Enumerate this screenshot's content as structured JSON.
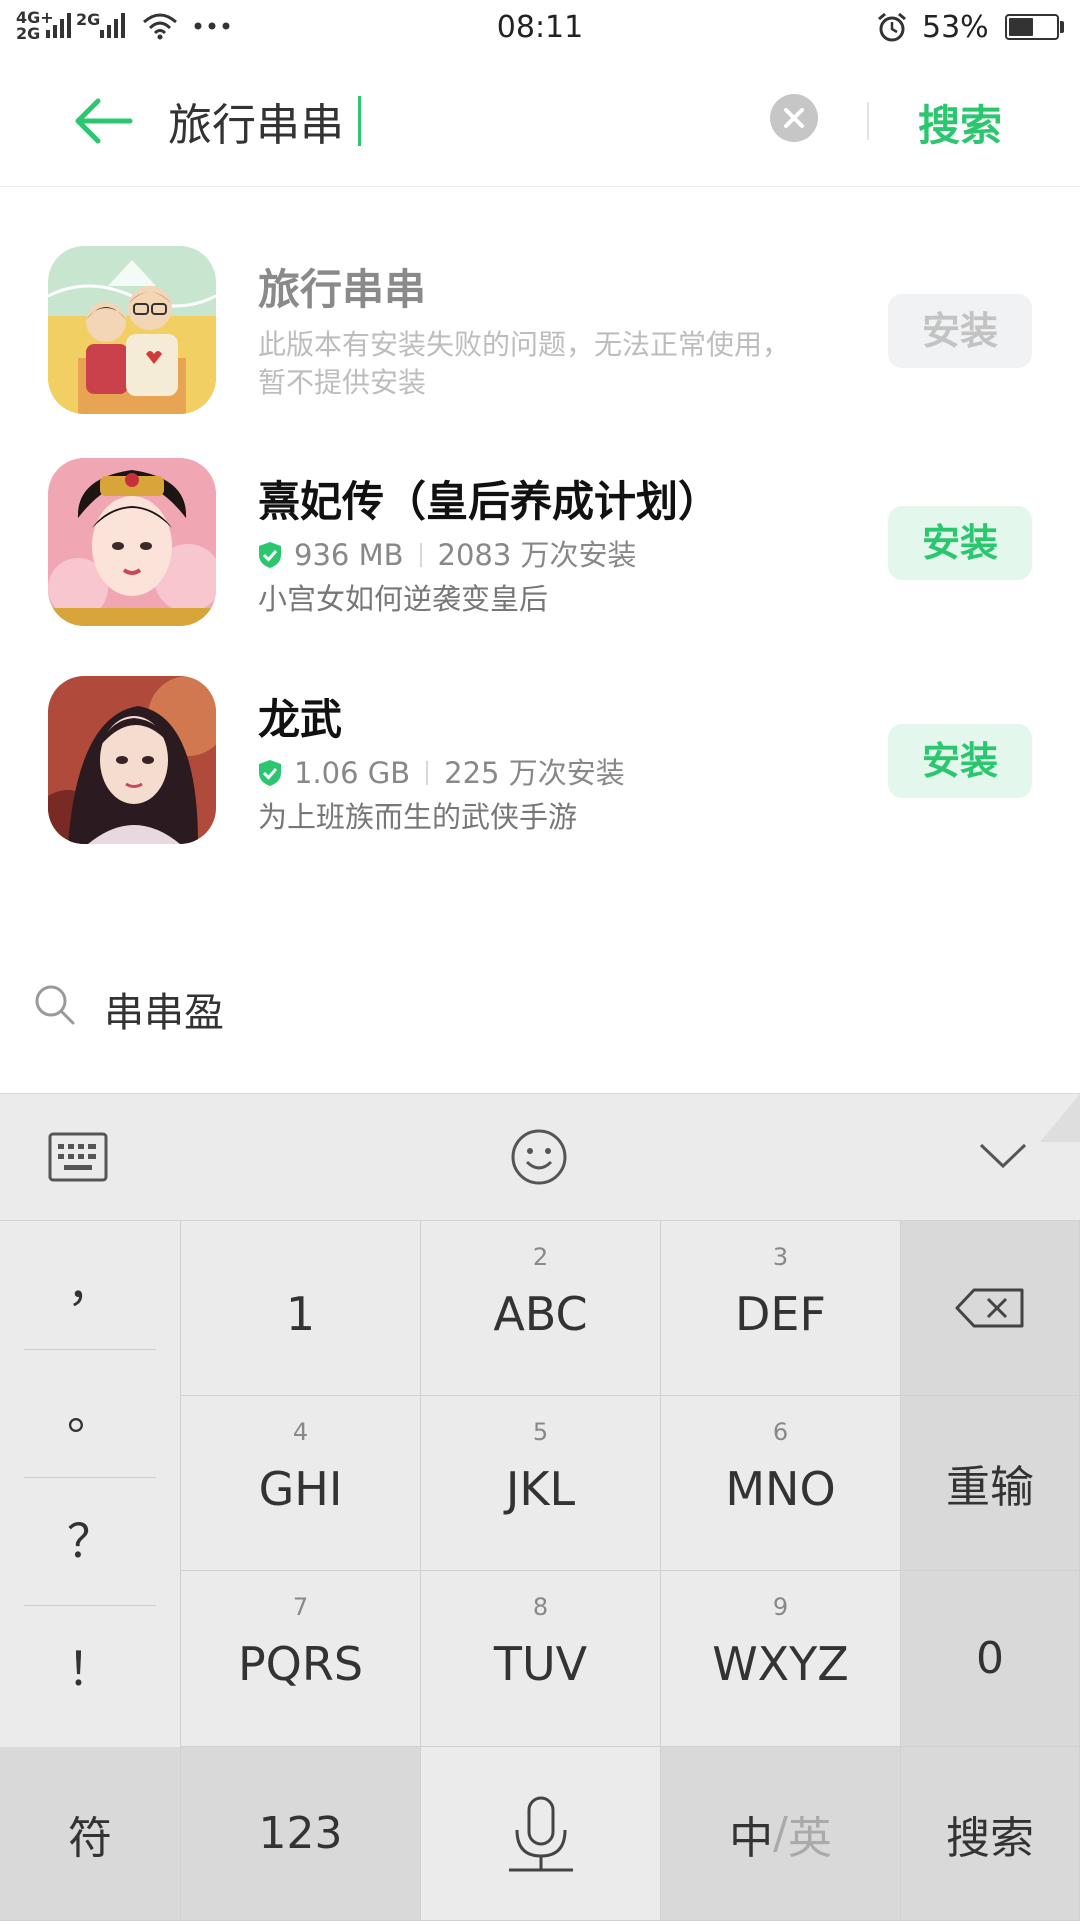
{
  "status_bar": {
    "network_top": "4G+",
    "network_bottom": "2G",
    "network2": "2G",
    "time": "08:11",
    "battery_pct": "53%",
    "battery_level": 0.53
  },
  "search": {
    "query": "旅行串串",
    "search_label": "搜索"
  },
  "apps": [
    {
      "title": "旅行串串",
      "description": "此版本有安装失败的问题，无法正常使用，暂不提供安装",
      "install_label": "安装",
      "enabled": false
    },
    {
      "title": "熹妃传（皇后养成计划）",
      "size": "936 MB",
      "installs": "2083 万次安装",
      "description": "小宫女如何逆袭变皇后",
      "install_label": "安装",
      "enabled": true
    },
    {
      "title": "龙武",
      "size": "1.06 GB",
      "installs": "225 万次安装",
      "description": "为上班族而生的武侠手游",
      "install_label": "安装",
      "enabled": true
    }
  ],
  "suggestion": {
    "text": "串串盈"
  },
  "keyboard": {
    "punctuation": [
      "，",
      "。",
      "？",
      "！"
    ],
    "keys": [
      {
        "num": "",
        "label": "1"
      },
      {
        "num": "2",
        "label": "ABC"
      },
      {
        "num": "3",
        "label": "DEF"
      },
      {
        "num": "4",
        "label": "GHI"
      },
      {
        "num": "5",
        "label": "JKL"
      },
      {
        "num": "6",
        "label": "MNO"
      },
      {
        "num": "7",
        "label": "PQRS"
      },
      {
        "num": "8",
        "label": "TUV"
      },
      {
        "num": "9",
        "label": "WXYZ"
      }
    ],
    "reenter": "重输",
    "zero": "0",
    "symbols": "符",
    "numbers": "123",
    "lang_zh": "中",
    "lang_sep": "/",
    "lang_en": "英",
    "search": "搜索"
  },
  "colors": {
    "accent": "#2bc76f",
    "install_bg": "#e3f7ec",
    "keyboard_bg": "#ebebeb"
  }
}
